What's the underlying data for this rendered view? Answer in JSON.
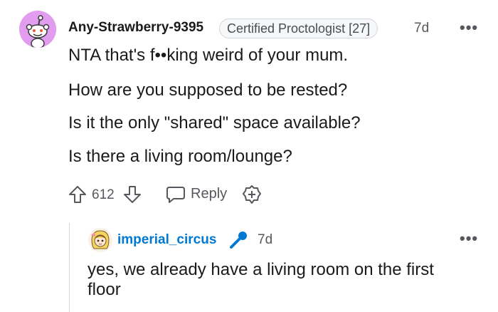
{
  "comment": {
    "author": "Any-Strawberry-9395",
    "flair": "Certified Proctologist [27]",
    "age": "7d",
    "lines": [
      "NTA that's f••king weird of your mum.",
      "How are you supposed to be rested?",
      "Is it the only \"shared\" space available?",
      "Is there a living room/lounge?"
    ],
    "score": "612",
    "reply_label": "Reply",
    "more_label": "•••"
  },
  "reply": {
    "author": "imperial_circus",
    "age": "7d",
    "text": "yes, we already have a living room on the first floor",
    "more_label": "•••"
  },
  "colors": {
    "avatar_bg": "#e29cf0",
    "username_link": "#0079d3",
    "mic_badge": "#0079d3",
    "muted_text": "#55585c"
  }
}
